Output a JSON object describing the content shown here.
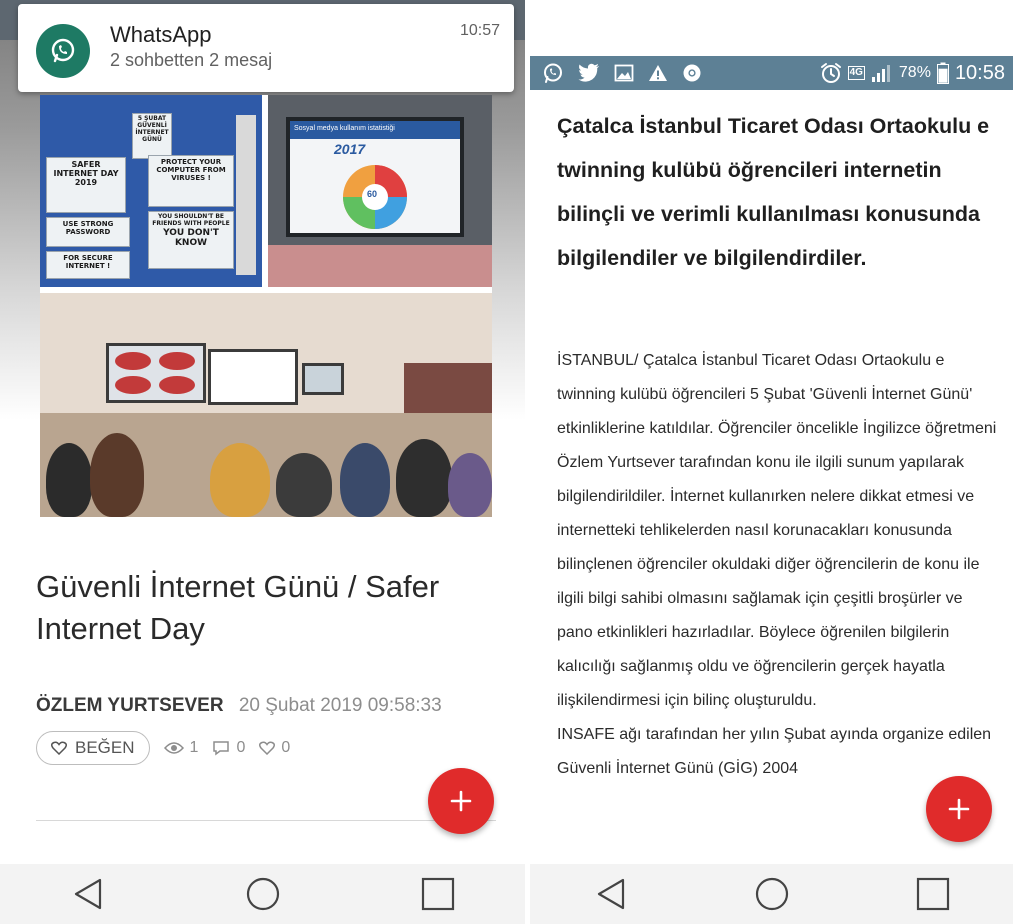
{
  "left_screen": {
    "notification": {
      "app_name": "WhatsApp",
      "summary": "2 sohbetten 2 mesaj",
      "time": "10:57",
      "icon": "whatsapp-icon"
    },
    "photo_texts": {
      "date_note": "5 ŞUBAT GÜVENLİ İNTERNET GÜNÜ",
      "safer_internet": "SAFER INTERNET DAY 2019",
      "protect": "PROTECT YOUR COMPUTER FROM VIRUSES !",
      "password": "USE STRONG PASSWORD",
      "secure": "FOR SECURE INTERNET !",
      "friends": "YOU SHOULDN'T BE FRIENDS WITH PEOPLE",
      "dont_know": "YOU DON'T KNOW",
      "slide_heading": "Sosyal medya kullanım istatistiği",
      "slide_year": "2017",
      "slide_number": "60"
    },
    "article": {
      "title": "Güvenli İnternet Günü / Safer Internet Day",
      "author": "ÖZLEM YURTSEVER",
      "date": "20 Şubat 2019 09:58:33",
      "like_label": "BEĞEN",
      "views": "1",
      "comments": "0",
      "likes": "0"
    },
    "fab_label": "+"
  },
  "right_screen": {
    "status_bar": {
      "battery": "78%",
      "time": "10:58",
      "network": "4G",
      "left_icons": [
        "whatsapp-icon",
        "twitter-icon",
        "image-icon",
        "warning-icon",
        "chrome-icon"
      ]
    },
    "title": "Çatalca İstanbul Ticaret Odası Ortaokulu e twinning kulübü öğrencileri internetin bilinçli ve verimli kullanılması konusunda bilgilendiler ve bilgilendirdiler.",
    "paragraph_1": "İSTANBUL/ Çatalca İstanbul Ticaret Odası Ortaokulu e twinning kulübü öğrencileri 5 Şubat 'Güvenli İnternet Günü' etkinliklerine katıldılar. Öğrenciler öncelikle İngilizce öğretmeni Özlem Yurtsever tarafından konu ile ilgili sunum yapılarak bilgilendirildiler. İnternet kullanırken nelere dikkat etmesi ve internetteki tehlikelerden nasıl korunacakları konusunda bilinçlenen öğrenciler okuldaki diğer öğrencilerin de konu ile ilgili bilgi sahibi olmasını sağlamak için çeşitli broşürler ve pano etkinlikleri hazırladılar. Böylece öğrenilen bilgilerin kalıcılığı sağlanmış oldu ve öğrencilerin gerçek hayatla ilişkilendirmesi için bilinç oluşturuldu.",
    "paragraph_2": "INSAFE ağı tarafından her yılın Şubat ayında organize edilen Güvenli İnternet Günü (GİG) 2004",
    "fab_label": "+"
  },
  "nav": {
    "back": "back-icon",
    "home": "home-icon",
    "recents": "recents-icon"
  }
}
